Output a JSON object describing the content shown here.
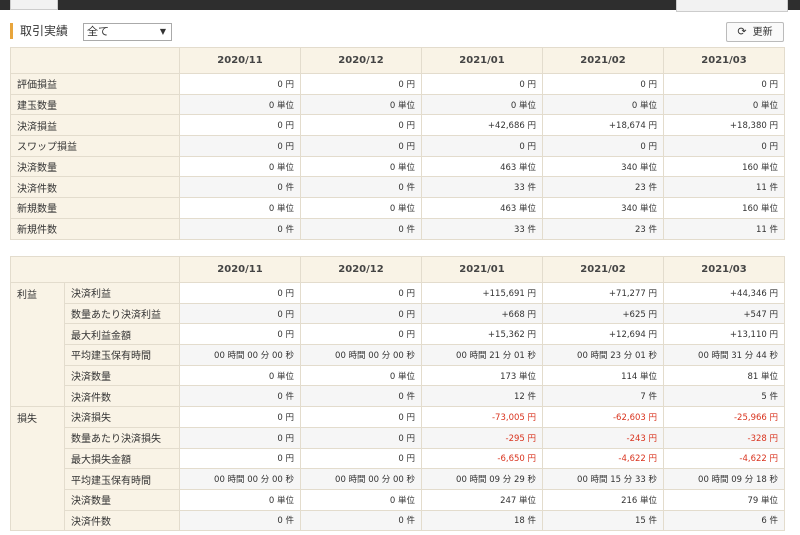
{
  "header": {
    "section_title": "取引実績",
    "filter_value": "全て",
    "refresh_label": "更新"
  },
  "months": [
    "2020/11",
    "2020/12",
    "2021/01",
    "2021/02",
    "2021/03"
  ],
  "table1": {
    "rows": [
      {
        "label": "評価損益",
        "values": [
          "0 円",
          "0 円",
          "0 円",
          "0 円",
          "0 円"
        ]
      },
      {
        "label": "建玉数量",
        "values": [
          "0 単位",
          "0 単位",
          "0 単位",
          "0 単位",
          "0 単位"
        ]
      },
      {
        "label": "決済損益",
        "values": [
          "0 円",
          "0 円",
          "+42,686 円",
          "+18,674 円",
          "+18,380 円"
        ]
      },
      {
        "label": "スワップ損益",
        "values": [
          "0 円",
          "0 円",
          "0 円",
          "0 円",
          "0 円"
        ]
      },
      {
        "label": "決済数量",
        "values": [
          "0 単位",
          "0 単位",
          "463 単位",
          "340 単位",
          "160 単位"
        ]
      },
      {
        "label": "決済件数",
        "values": [
          "0 件",
          "0 件",
          "33 件",
          "23 件",
          "11 件"
        ]
      },
      {
        "label": "新規数量",
        "values": [
          "0 単位",
          "0 単位",
          "463 単位",
          "340 単位",
          "160 単位"
        ]
      },
      {
        "label": "新規件数",
        "values": [
          "0 件",
          "0 件",
          "33 件",
          "23 件",
          "11 件"
        ]
      }
    ]
  },
  "table2": {
    "groups": [
      {
        "label": "利益",
        "rows": [
          {
            "label": "決済利益",
            "negative": false,
            "values": [
              "0 円",
              "0 円",
              "+115,691 円",
              "+71,277 円",
              "+44,346 円"
            ]
          },
          {
            "label": "数量あたり決済利益",
            "negative": false,
            "values": [
              "0 円",
              "0 円",
              "+668 円",
              "+625 円",
              "+547 円"
            ]
          },
          {
            "label": "最大利益金額",
            "negative": false,
            "values": [
              "0 円",
              "0 円",
              "+15,362 円",
              "+12,694 円",
              "+13,110 円"
            ]
          },
          {
            "label": "平均建玉保有時間",
            "negative": false,
            "values": [
              "00 時間 00 分 00 秒",
              "00 時間 00 分 00 秒",
              "00 時間 21 分 01 秒",
              "00 時間 23 分 01 秒",
              "00 時間 31 分 44 秒"
            ]
          },
          {
            "label": "決済数量",
            "negative": false,
            "values": [
              "0 単位",
              "0 単位",
              "173 単位",
              "114 単位",
              "81 単位"
            ]
          },
          {
            "label": "決済件数",
            "negative": false,
            "values": [
              "0 件",
              "0 件",
              "12 件",
              "7 件",
              "5 件"
            ]
          }
        ]
      },
      {
        "label": "損失",
        "rows": [
          {
            "label": "決済損失",
            "negative": true,
            "values": [
              "0 円",
              "0 円",
              "-73,005 円",
              "-62,603 円",
              "-25,966 円"
            ]
          },
          {
            "label": "数量あたり決済損失",
            "negative": true,
            "values": [
              "0 円",
              "0 円",
              "-295 円",
              "-243 円",
              "-328 円"
            ]
          },
          {
            "label": "最大損失金額",
            "negative": true,
            "values": [
              "0 円",
              "0 円",
              "-6,650 円",
              "-4,622 円",
              "-4,622 円"
            ]
          },
          {
            "label": "平均建玉保有時間",
            "negative": false,
            "values": [
              "00 時間 00 分 00 秒",
              "00 時間 00 分 00 秒",
              "00 時間 09 分 29 秒",
              "00 時間 15 分 33 秒",
              "00 時間 09 分 18 秒"
            ]
          },
          {
            "label": "決済数量",
            "negative": false,
            "values": [
              "0 単位",
              "0 単位",
              "247 単位",
              "216 単位",
              "79 単位"
            ]
          },
          {
            "label": "決済件数",
            "negative": false,
            "values": [
              "0 件",
              "0 件",
              "18 件",
              "15 件",
              "6 件"
            ]
          }
        ]
      }
    ]
  },
  "colors": {
    "accent": "#e8a53c",
    "header_bg": "#f9f3e6",
    "negative": "#d9341f"
  }
}
